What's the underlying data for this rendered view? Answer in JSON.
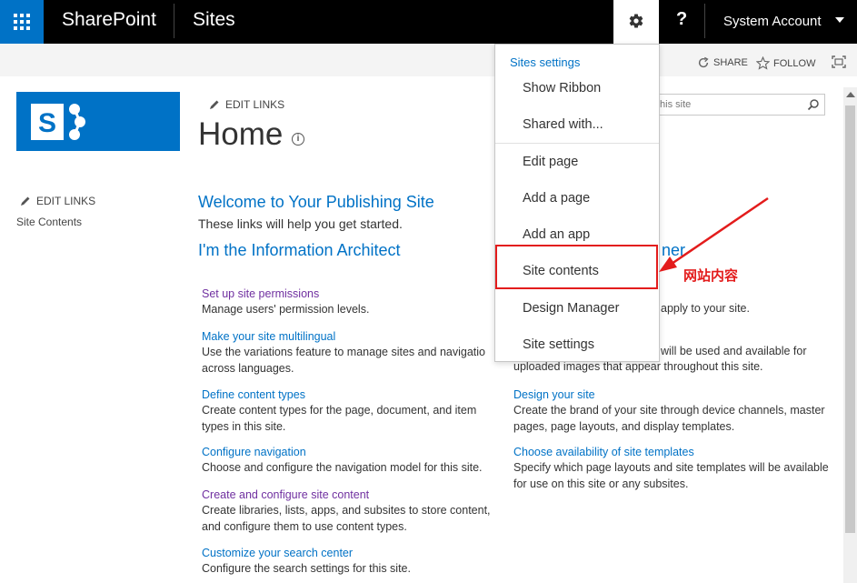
{
  "suite_bar": {
    "brand": "SharePoint",
    "sites_link": "Sites",
    "help_glyph": "?",
    "account_name": "System Account"
  },
  "ribbon": {
    "share_label": "SHARE",
    "follow_label": "FOLLOW"
  },
  "header": {
    "edit_links": "EDIT LINKS",
    "page_title": "Home",
    "search_placeholder": "this site"
  },
  "left_nav": {
    "edit_links": "EDIT LINKS",
    "items": [
      {
        "label": "Site Contents"
      }
    ]
  },
  "main": {
    "welcome_title": "Welcome to Your Publishing Site",
    "welcome_subtitle": "These links will help you get started.",
    "ia_title": "I'm the Information Architect",
    "right_heading_fragment": "ner",
    "left_tasks": [
      {
        "link": "Set up site permissions",
        "desc": "Manage users' permission levels.",
        "visited": true
      },
      {
        "link": "Make your site multilingual",
        "desc": "Use the variations feature to manage sites and navigatio across languages.",
        "visited": false
      },
      {
        "link": "Define content types",
        "desc": "Create content types for the page, document, and item types in this site.",
        "visited": false
      },
      {
        "link": "Configure navigation",
        "desc": "Choose and configure the navigation model for this site.",
        "visited": false
      },
      {
        "link": "Create and configure site content",
        "desc": "Create libraries, lists, apps, and subsites to store content, and configure them to use content types.",
        "visited": true
      },
      {
        "link": "Customize your search center",
        "desc": "Configure the search settings for this site.",
        "visited": false
      }
    ],
    "right_fragments": [
      "apply to your site.",
      "will be used and available for",
      "uploaded images that appear throughout this site."
    ],
    "right_tasks": [
      {
        "link": "Design your site",
        "desc": "Create the brand of your site through device channels, master pages, page layouts, and display templates."
      },
      {
        "link": "Choose availability of site templates",
        "desc": "Specify which page layouts and site templates will be available for use on this site or any subsites."
      }
    ]
  },
  "settings_menu": {
    "header": "Sites settings",
    "items": [
      {
        "label": "Show Ribbon"
      },
      {
        "label": "Shared with..."
      },
      {
        "label": "Edit page"
      },
      {
        "label": "Add a page"
      },
      {
        "label": "Add an app"
      },
      {
        "label": "Site contents"
      },
      {
        "label": "Design Manager"
      },
      {
        "label": "Site settings"
      }
    ]
  },
  "annotation": {
    "label": "网站内容",
    "color": "#e31c1c"
  },
  "colors": {
    "accent": "#0072c6",
    "suite_bar": "#000000",
    "visited_link": "#7030a0"
  },
  "icons": {
    "app_launcher": "waffle-icon",
    "settings": "gear-icon",
    "help": "help-icon",
    "share": "share-icon",
    "follow": "star-icon",
    "focus": "focus-mode-icon",
    "edit": "pencil-icon",
    "info": "info-icon",
    "search": "search-icon"
  }
}
